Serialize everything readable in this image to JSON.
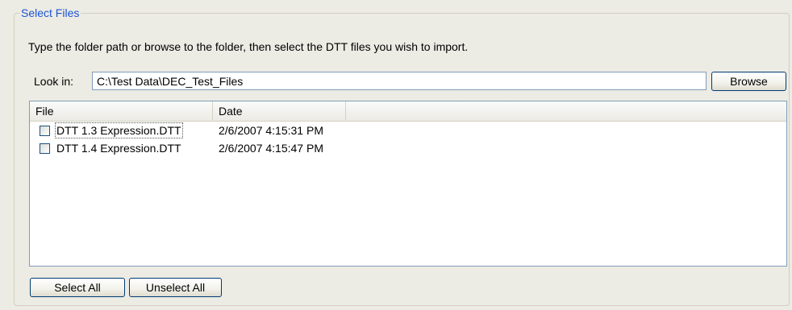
{
  "group": {
    "title": "Select Files"
  },
  "instructions": "Type the folder path or browse to the folder, then select the DTT files you wish to import.",
  "lookin": {
    "label": "Look in:",
    "path_value": "C:\\Test Data\\DEC_Test_Files",
    "browse_label": "Browse"
  },
  "list": {
    "columns": [
      "File",
      "Date"
    ],
    "rows": [
      {
        "file": "DTT 1.3 Expression.DTT",
        "date": "2/6/2007 4:15:31 PM",
        "checked": false
      },
      {
        "file": "DTT 1.4 Expression.DTT",
        "date": "2/6/2007 4:15:47 PM",
        "checked": false
      }
    ]
  },
  "buttons": {
    "select_all": "Select All",
    "unselect_all": "Unselect All"
  },
  "colors": {
    "group_title": "#1c54d6",
    "panel_bg": "#ecebe4",
    "border": "#7f9db9"
  }
}
